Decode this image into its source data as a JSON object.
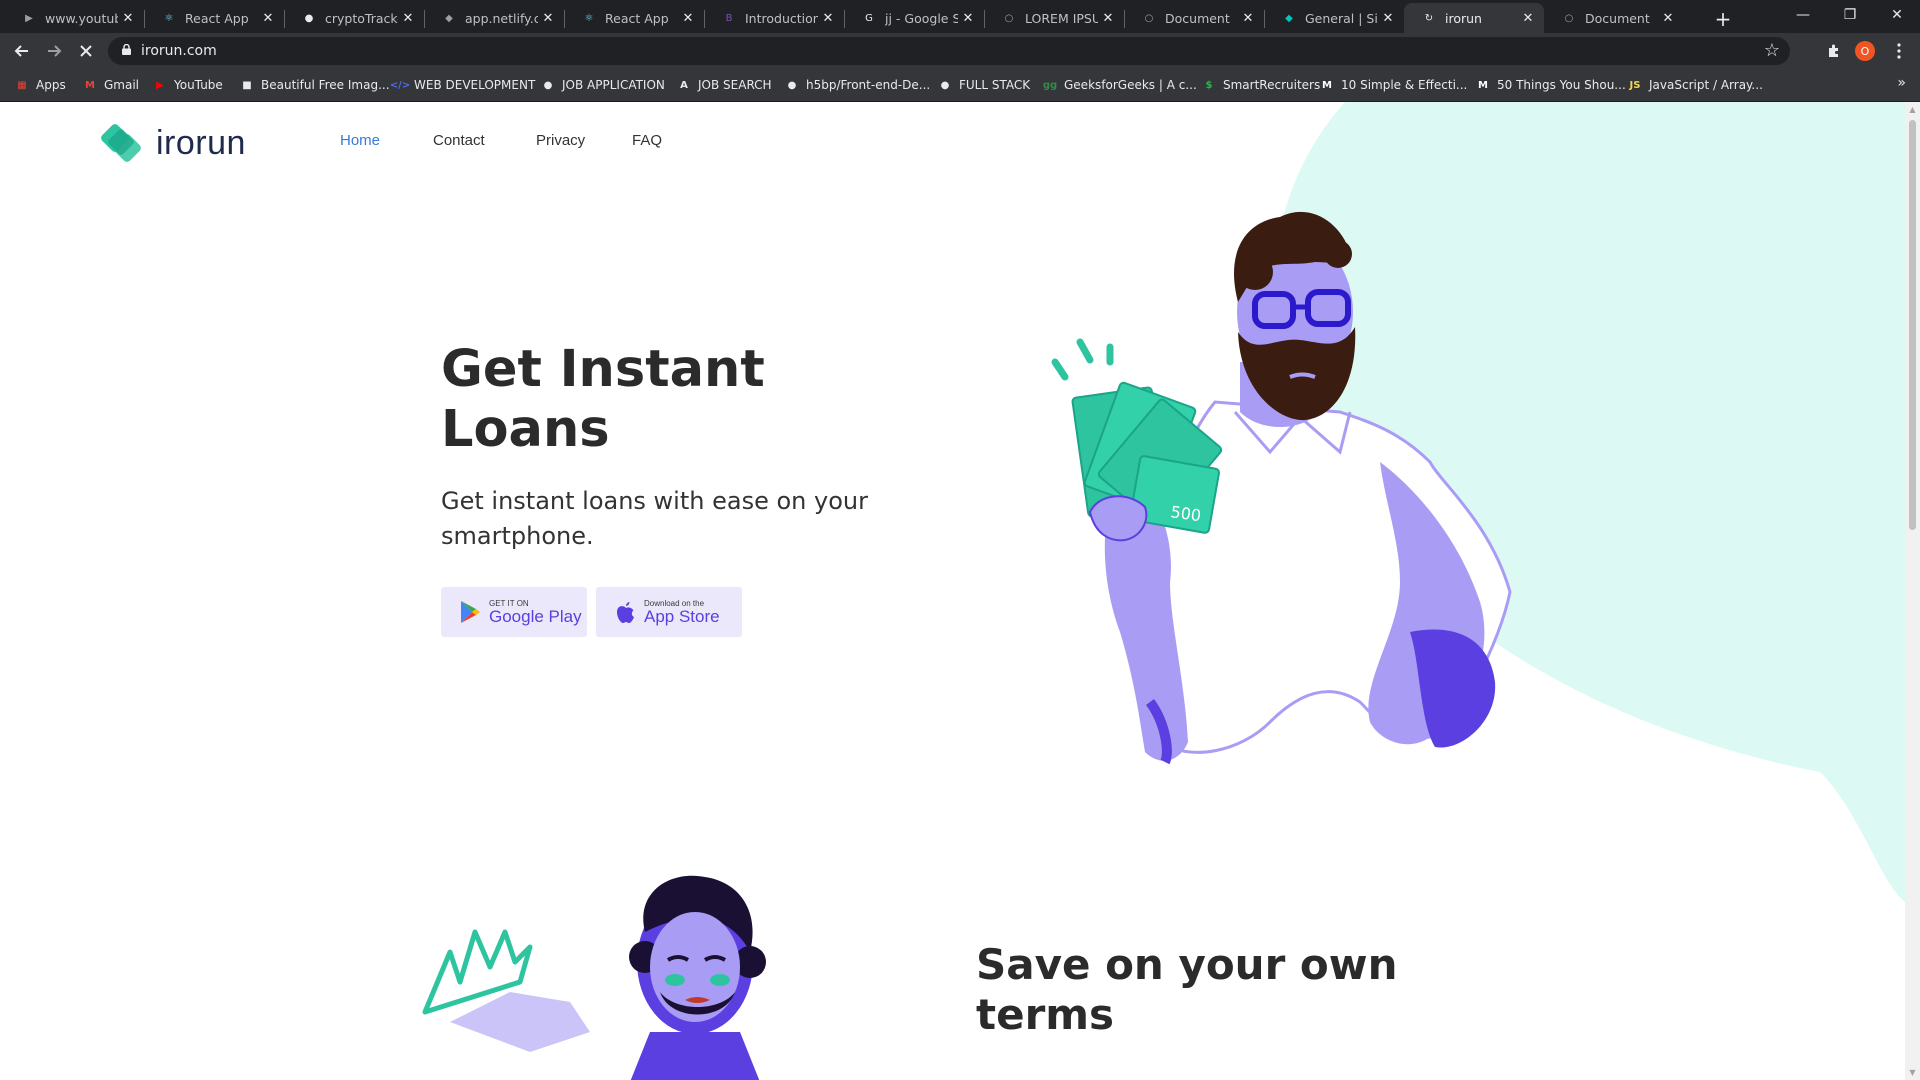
{
  "browser": {
    "tabs": [
      {
        "label": "www.youtube.",
        "icon": "youtube-icon",
        "color": "#9aa0a6",
        "glyph": "▶"
      },
      {
        "label": "React App",
        "icon": "react-icon",
        "color": "#61dafb",
        "glyph": "⚛"
      },
      {
        "label": "cryptoTracker/",
        "icon": "github-icon",
        "color": "#e8eaed",
        "glyph": "●"
      },
      {
        "label": "app.netlify.cor",
        "icon": "netlify-icon",
        "color": "#9aa0a6",
        "glyph": "◆"
      },
      {
        "label": "React App",
        "icon": "react-icon",
        "color": "#61dafb",
        "glyph": "⚛"
      },
      {
        "label": "Introduction",
        "icon": "bootstrap-icon",
        "color": "#7952b3",
        "glyph": "B"
      },
      {
        "label": "jj - Google Sea",
        "icon": "google-icon",
        "color": "#e8eaed",
        "glyph": "G"
      },
      {
        "label": "LOREM IPSUM",
        "icon": "globe-icon",
        "color": "#9aa0a6",
        "glyph": "○"
      },
      {
        "label": "Document",
        "icon": "globe-icon",
        "color": "#9aa0a6",
        "glyph": "○"
      },
      {
        "label": "General | Site",
        "icon": "site-icon",
        "color": "#00c7b7",
        "glyph": "◆"
      },
      {
        "label": "irorun",
        "icon": "loading-icon",
        "color": "#e8eaed",
        "glyph": "↻",
        "active": true
      },
      {
        "label": "Document",
        "icon": "globe-icon",
        "color": "#9aa0a6",
        "glyph": "○"
      }
    ],
    "new_tab": "+",
    "window_controls": {
      "minimize": "—",
      "restore": "❐",
      "close": "✕"
    },
    "url": "irorun.com",
    "profile_initial": "O",
    "bookmarks": [
      {
        "label": "Apps",
        "icon": "apps-grid-icon",
        "color": "#ea4335",
        "glyph": "▦"
      },
      {
        "label": "Gmail",
        "icon": "gmail-icon",
        "color": "#ea4335",
        "glyph": "M"
      },
      {
        "label": "YouTube",
        "icon": "youtube-icon",
        "color": "#ff0000",
        "glyph": "▶"
      },
      {
        "label": "Beautiful Free Imag...",
        "icon": "unsplash-icon",
        "color": "#e8eaed",
        "glyph": "■"
      },
      {
        "label": "WEB DEVELOPMENT",
        "icon": "code-icon",
        "color": "#4a6cf7",
        "glyph": "</>"
      },
      {
        "label": "JOB APPLICATION",
        "icon": "github-icon",
        "color": "#e8eaed",
        "glyph": "●"
      },
      {
        "label": "JOB SEARCH",
        "icon": "angellist-icon",
        "color": "#e8eaed",
        "glyph": "A"
      },
      {
        "label": "h5bp/Front-end-De...",
        "icon": "github-icon",
        "color": "#e8eaed",
        "glyph": "●"
      },
      {
        "label": "FULL STACK",
        "icon": "github-icon",
        "color": "#e8eaed",
        "glyph": "●"
      },
      {
        "label": "GeeksforGeeks | A c...",
        "icon": "geeksforgeeks-icon",
        "color": "#2f8d46",
        "glyph": "gg"
      },
      {
        "label": "SmartRecruiters",
        "icon": "smartrecruiters-icon",
        "color": "#2fb34a",
        "glyph": "$"
      },
      {
        "label": "10 Simple & Effecti...",
        "icon": "medium-icon",
        "color": "#ffffff",
        "glyph": "M"
      },
      {
        "label": "50 Things You Shou...",
        "icon": "medium-icon",
        "color": "#ffffff",
        "glyph": "M"
      },
      {
        "label": "JavaScript / Array...",
        "icon": "javascript-icon",
        "color": "#f0db4f",
        "glyph": "JS"
      }
    ],
    "bookmarks_more": "»"
  },
  "page": {
    "logo_text": "irorun",
    "nav": [
      {
        "label": "Home",
        "active": true
      },
      {
        "label": "Contact"
      },
      {
        "label": "Privacy"
      },
      {
        "label": "FAQ"
      }
    ],
    "hero": {
      "title_line1": "Get Instant",
      "title_line2": "Loans",
      "subtitle_line1": "Get instant loans with ease on your",
      "subtitle_line2": "smartphone."
    },
    "store_buttons": {
      "google": {
        "small": "GET IT ON",
        "big": "Google Play"
      },
      "apple": {
        "small": "Download on the",
        "big": "App Store"
      }
    },
    "illustration": {
      "banknote_value": "500"
    },
    "section2": {
      "title_line1": "Save on your own",
      "title_line2": "terms"
    }
  },
  "colors": {
    "brand_green": "#2ec4a0",
    "brand_purple": "#5b3fe0",
    "light_purple": "#a99cf5",
    "mint_blob": "#dcfaf3",
    "nav_active": "#3a7bd5"
  }
}
